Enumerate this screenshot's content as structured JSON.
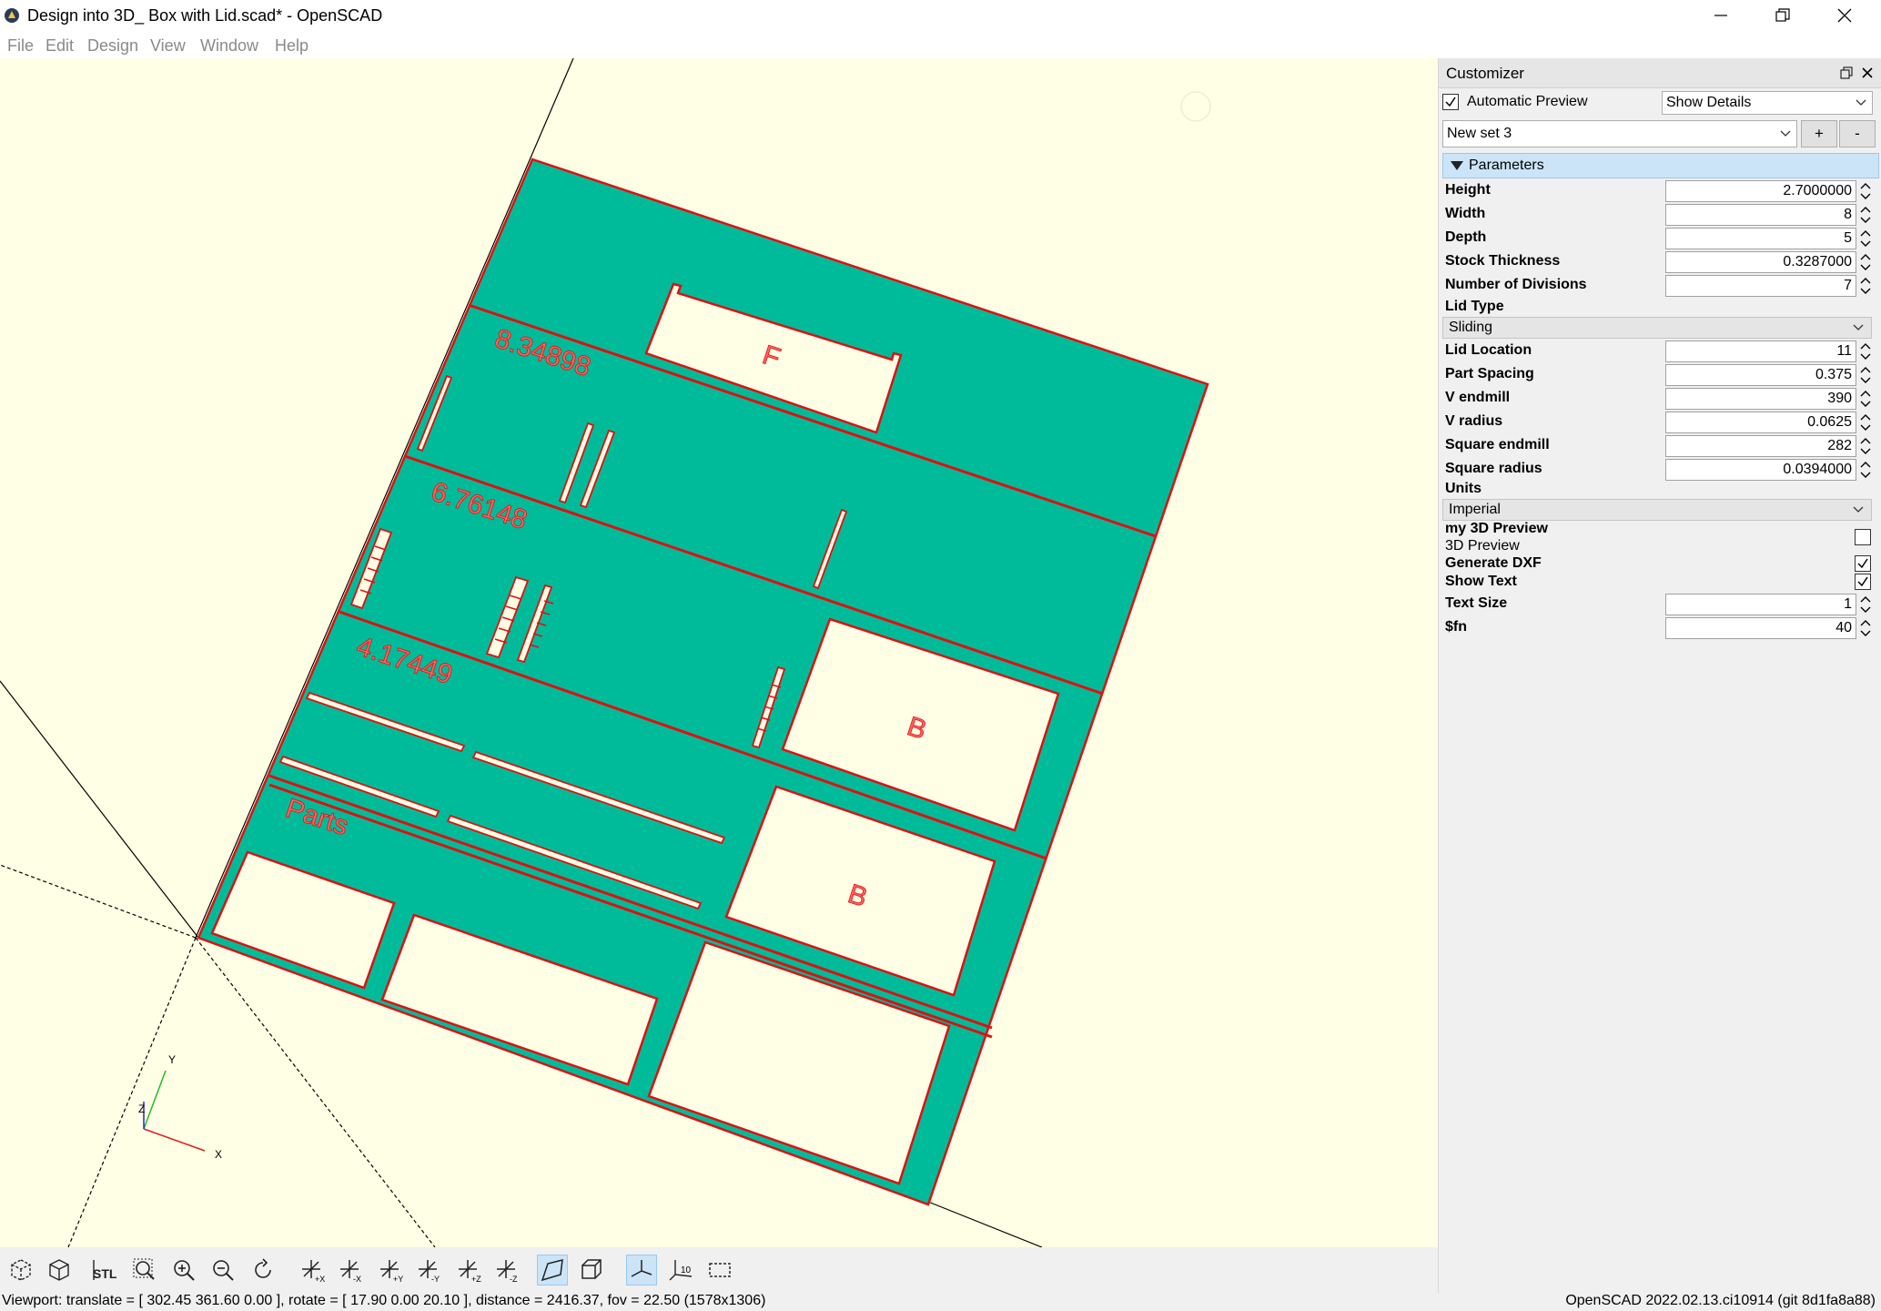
{
  "window": {
    "title": "Design into 3D_ Box with Lid.scad* - OpenSCAD"
  },
  "menu": [
    "File",
    "Edit",
    "Design",
    "View",
    "Window",
    "Help"
  ],
  "viewport": {
    "background": "#ffffe5",
    "part_fill": "#00bb99",
    "outline": "#dd1111",
    "labels": {
      "l1": "8.34898",
      "l2": "6.76148",
      "l3": "4.17449",
      "l4": "Parts",
      "f": "F",
      "b1": "B",
      "b2": "B"
    },
    "axes": {
      "x": "X",
      "y": "Y",
      "z": "Z"
    }
  },
  "customizer": {
    "title": "Customizer",
    "auto_preview_label": "Automatic Preview",
    "auto_preview_checked": true,
    "details_select": "Show Details",
    "preset_select": "New set 3",
    "add_label": "+",
    "remove_label": "-",
    "section_title": "Parameters",
    "params": {
      "height": {
        "label": "Height",
        "value": "2.7000000"
      },
      "width": {
        "label": "Width",
        "value": "8"
      },
      "depth": {
        "label": "Depth",
        "value": "5"
      },
      "stock": {
        "label": "Stock Thickness",
        "value": "0.3287000"
      },
      "divisions": {
        "label": "Number of Divisions",
        "value": "7"
      },
      "lid_type": {
        "label": "Lid Type",
        "value": "Sliding"
      },
      "lid_location": {
        "label": "Lid Location",
        "value": "11"
      },
      "part_spacing": {
        "label": "Part Spacing",
        "value": "0.375"
      },
      "v_endmill": {
        "label": "V endmill",
        "value": "390"
      },
      "v_radius": {
        "label": "V radius",
        "value": "0.0625"
      },
      "sq_endmill": {
        "label": "Square endmill",
        "value": "282"
      },
      "sq_radius": {
        "label": "Square radius",
        "value": "0.0394000"
      },
      "units": {
        "label": "Units",
        "value": "Imperial"
      },
      "my3d": {
        "label": "my 3D Preview",
        "sub": "3D Preview",
        "checked": false
      },
      "dxf": {
        "label": "Generate DXF",
        "checked": true
      },
      "show_text": {
        "label": "Show Text",
        "checked": true
      },
      "text_size": {
        "label": "Text Size",
        "value": "1"
      },
      "fn": {
        "label": "$fn",
        "value": "40"
      }
    }
  },
  "status": {
    "left": "Viewport: translate = [ 302.45 361.60 0.00 ], rotate = [ 17.90 0.00 20.10 ], distance = 2416.37, fov = 22.50 (1578x1306)",
    "right": "OpenSCAD 2022.02.13.ci10914 (git 8d1fa8a88)"
  },
  "toolbar": [
    "preview-icon",
    "render-icon",
    "export-stl-icon",
    "view-all-icon",
    "zoom-in-icon",
    "zoom-out-icon",
    "reset-view-icon",
    "view-right-icon",
    "view-left-icon",
    "view-back-icon",
    "view-front-icon",
    "view-top-icon",
    "view-bottom-icon",
    "perspective-icon",
    "orthogonal-icon",
    "show-axes-icon",
    "show-scale-icon",
    "show-edges-icon"
  ]
}
